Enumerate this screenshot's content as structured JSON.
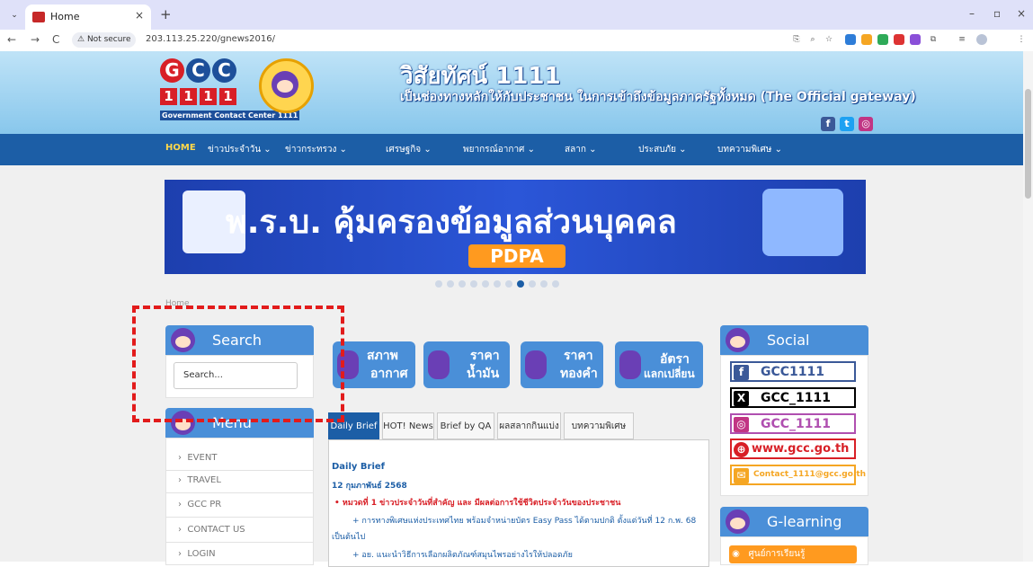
{
  "browser": {
    "tab_title": "Home",
    "tab_close": "×",
    "new_tab": "+",
    "window_controls": [
      "–",
      "▫",
      "×"
    ],
    "security": "Not secure",
    "url": "203.113.25.220/gnews2016/"
  },
  "header": {
    "logo_letters": [
      "G",
      "C",
      "C"
    ],
    "logo_number": [
      "1",
      "1",
      "1",
      "1"
    ],
    "logo_caption": "Government Contact Center 1111",
    "title": "วิสัยทัศน์ 1111",
    "subtitle": "เป็นช่องทางหลักให้กับประชาชน ในการเข้าถึงข้อมูลภาครัฐทั้งหมด (The Official gateway)",
    "social_icons": [
      "f",
      "t",
      "◎"
    ]
  },
  "nav": {
    "items": [
      {
        "label": "HOME",
        "active": true
      },
      {
        "label": "ข่าวประจำวัน ⌄"
      },
      {
        "label": "ข่าวกระทรวง ⌄"
      },
      {
        "label": "เศรษฐกิจ ⌄"
      },
      {
        "label": "พยากรณ์อากาศ ⌄"
      },
      {
        "label": "สลาก ⌄"
      },
      {
        "label": "ประสบภัย ⌄"
      },
      {
        "label": "บทความพิเศษ ⌄"
      }
    ]
  },
  "banner": {
    "headline": "พ.ร.บ. คุ้มครองข้อมูลส่วนบุคคล",
    "tag": "PDPA",
    "slides": 11,
    "active_slide": 8
  },
  "breadcrumb": "Home",
  "search_widget": {
    "title": "Search",
    "placeholder": "Search..."
  },
  "menu_widget": {
    "title": "Menu",
    "items": [
      "EVENT",
      "TRAVEL",
      "GCC PR",
      "CONTACT US",
      "LOGIN"
    ]
  },
  "quick_links": [
    {
      "line1": "สภาพ",
      "line2": "อากาศ"
    },
    {
      "line1": "ราคา",
      "line2": "น้ำมัน"
    },
    {
      "line1": "ราคา",
      "line2": "ทองคำ"
    },
    {
      "line1": "อัตรา",
      "line2": "แลกเปลี่ยน"
    }
  ],
  "news_tabs": [
    "Daily Brief",
    "HOT! News",
    "Brief by QA",
    "ผลสลากกินแบ่ง",
    "บทความพิเศษ"
  ],
  "news": {
    "heading": "Daily Brief",
    "date": "12 กุมภาพันธ์ 2568",
    "category": "• หมวดที่ 1 ข่าวประจำวันที่สำคัญ และ มีผลต่อการใช้ชีวิตประจำวันของประชาชน",
    "item1": "+ การทางพิเศษแห่งประเทศไทย พร้อมจำหน่ายบัตร Easy Pass ได้ตามปกติ ตั้งแต่วันที่ 12 ก.พ. 68",
    "item1_cont": "เป็นต้นไป",
    "item2": "+ อย. แนะนำวิธีการเลือกผลิตภัณฑ์สมุนไพรอย่างไรให้ปลอดภัย"
  },
  "social_widget": {
    "title": "Social",
    "buttons": [
      {
        "icon": "f",
        "label": "GCC1111"
      },
      {
        "icon": "X",
        "label": "GCC_1111"
      },
      {
        "icon": "◎",
        "label": "GCC_1111"
      },
      {
        "icon": "⊕",
        "label": "www.gcc.go.th"
      },
      {
        "icon": "✉",
        "label": "Contact_1111@gcc.go.th"
      }
    ]
  },
  "glearning_widget": {
    "title": "G-learning",
    "thumb": "ศูนย์การเรียนรู้"
  },
  "colors": {
    "primary": "#1c5ea6",
    "widget": "#4a8fd8",
    "annotation": "#e21b1b"
  }
}
